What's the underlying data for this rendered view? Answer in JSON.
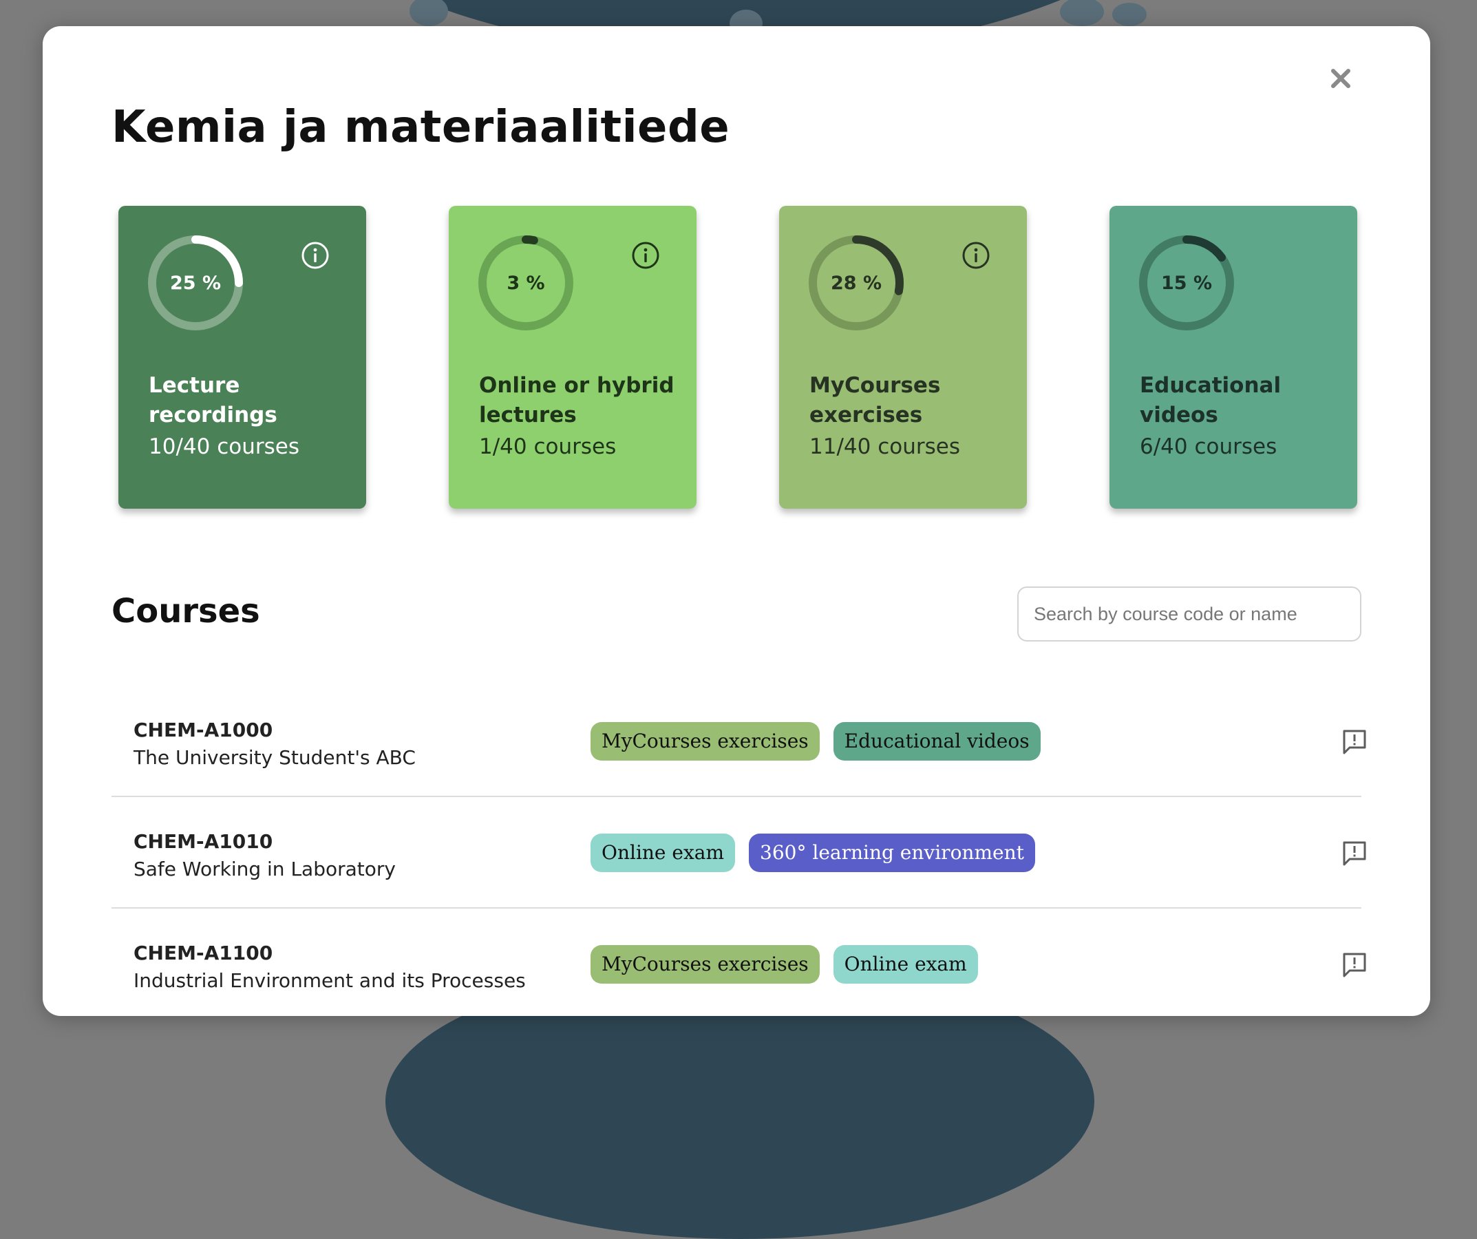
{
  "dialog": {
    "title": "Kemia ja materiaalitiede",
    "close_icon": "close-icon"
  },
  "cards": [
    {
      "percent_label": "25 %",
      "progress": 0.25,
      "title": "Lecture recordings",
      "count": "10/40 courses",
      "bg": "#4a8156",
      "text_color": "#ffffff",
      "track": "#84a98b",
      "arc": "#ffffff",
      "has_info": true
    },
    {
      "percent_label": "3 %",
      "progress": 0.03,
      "title": "Online or hybrid lectures",
      "count": "1/40 courses",
      "bg": "#8fd06e",
      "text_color": "#1d3418",
      "track": "#6aa553",
      "arc": "#253d20",
      "has_info": true
    },
    {
      "percent_label": "28 %",
      "progress": 0.28,
      "title": "MyCourses exercises",
      "count": "11/40 courses",
      "bg": "#9abd74",
      "text_color": "#263323",
      "track": "#78985a",
      "arc": "#2e3b2b",
      "has_info": true
    },
    {
      "percent_label": "15 %",
      "progress": 0.15,
      "title": "Educational videos",
      "count": "6/40 courses",
      "bg": "#5ea78a",
      "text_color": "#1c3129",
      "track": "#427c65",
      "arc": "#1f3a32",
      "has_info": false
    }
  ],
  "courses_section": {
    "title": "Courses",
    "search_placeholder": "Search by course code or name"
  },
  "courses": [
    {
      "code": "CHEM-A1000",
      "name": "The University Student's ABC",
      "tags": [
        {
          "label": "MyCourses exercises",
          "color": "#9abd74",
          "text": "#111111"
        },
        {
          "label": "Educational videos",
          "color": "#5ea78a",
          "text": "#111111"
        }
      ]
    },
    {
      "code": "CHEM-A1010",
      "name": "Safe Working in Laboratory",
      "tags": [
        {
          "label": "Online exam",
          "color": "#8fd7cd",
          "text": "#111111"
        },
        {
          "label": "360° learning environment",
          "color": "#5a5ec8",
          "text": "#ffffff"
        }
      ]
    },
    {
      "code": "CHEM-A1100",
      "name": "Industrial Environment and its Processes",
      "tags": [
        {
          "label": "MyCourses exercises",
          "color": "#9abd74",
          "text": "#111111"
        },
        {
          "label": "Online exam",
          "color": "#8fd7cd",
          "text": "#111111"
        }
      ]
    }
  ]
}
